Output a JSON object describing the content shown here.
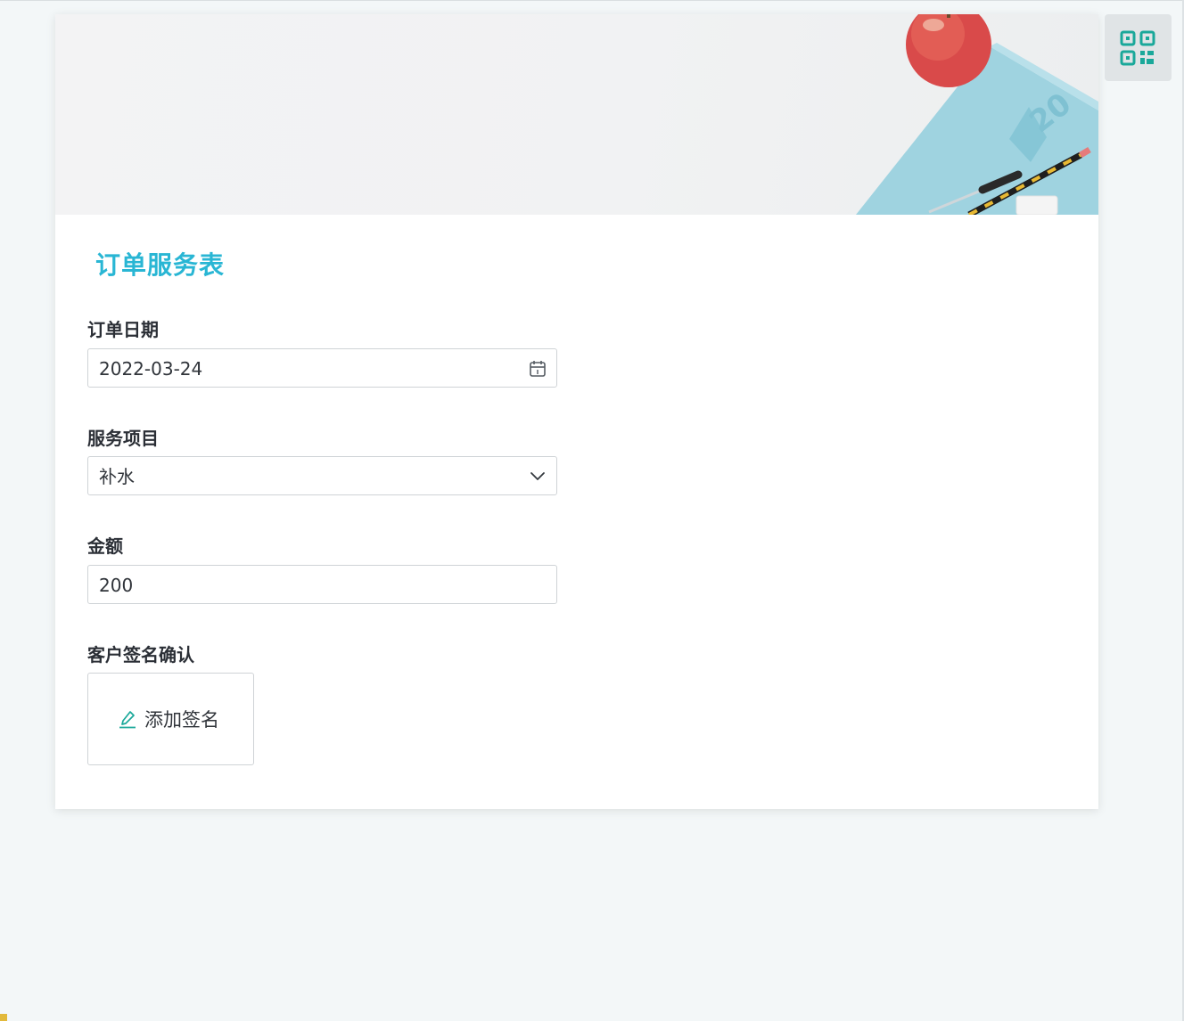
{
  "form": {
    "title": "订单服务表",
    "fields": [
      {
        "label": "订单日期",
        "value": "2022-03-24",
        "icon": "calendar-icon"
      },
      {
        "label": "服务项目",
        "value": "补水",
        "icon": "chevron-down-icon"
      },
      {
        "label": "金额",
        "value": "200"
      }
    ],
    "signature": {
      "label": "客户签名确认",
      "button_label": "添加签名",
      "icon": "pencil-icon"
    }
  },
  "qr_button": {
    "icon": "qr-code-icon"
  },
  "colors": {
    "title": "#29b6d4",
    "accent": "#1aa89a",
    "background": "#f3f7f8"
  }
}
